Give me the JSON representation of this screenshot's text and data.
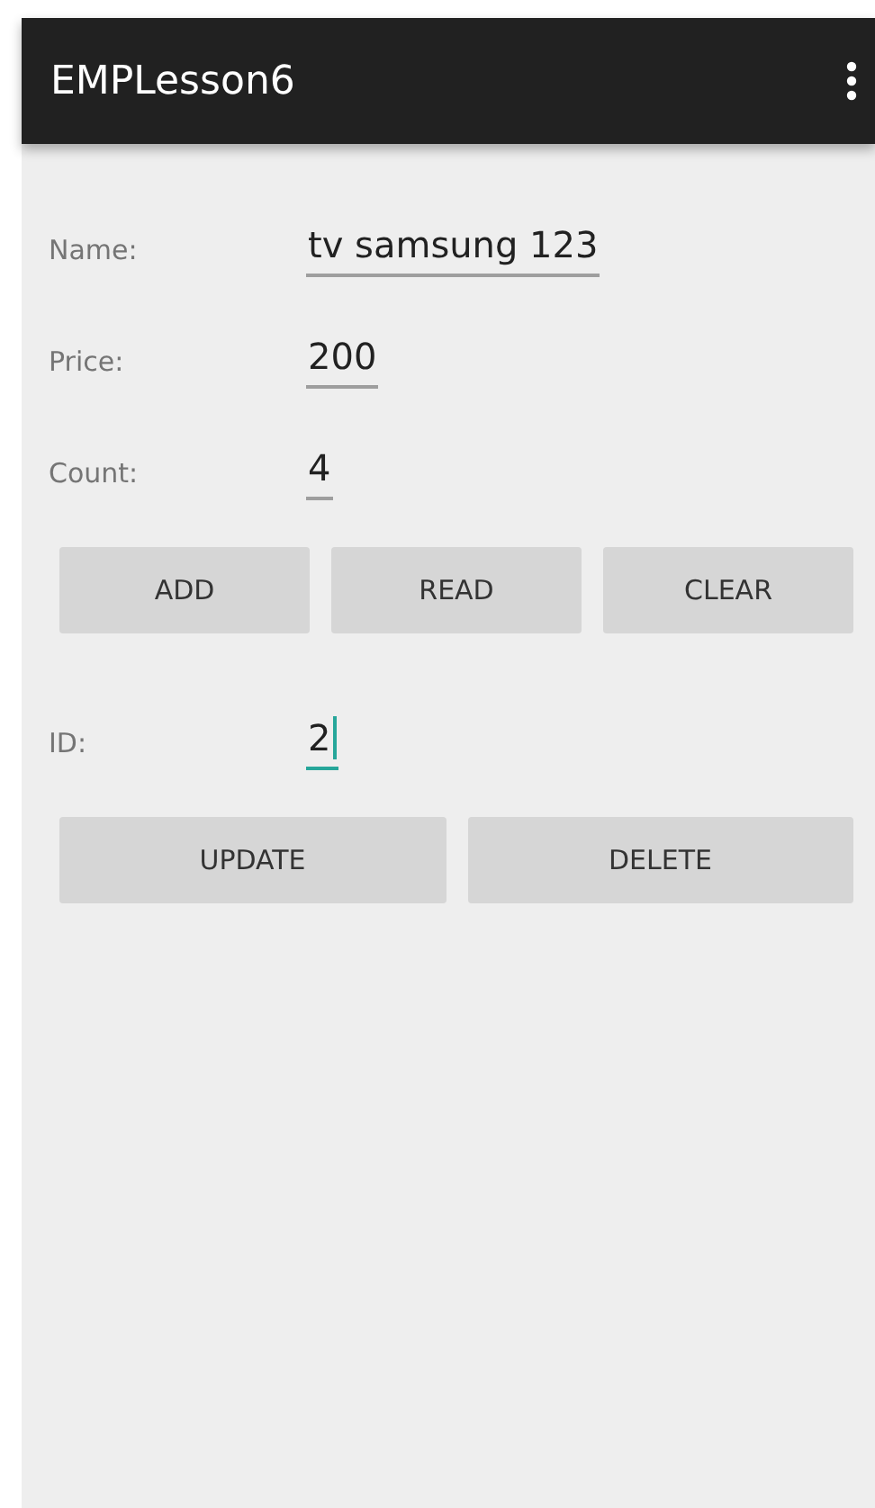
{
  "app_bar": {
    "title": "EMPLesson6"
  },
  "sections": [
    {
      "fields": [
        {
          "label": "Name:",
          "value": "tv samsung 123",
          "focused": false
        },
        {
          "label": "Price:",
          "value": "200",
          "focused": false
        },
        {
          "label": "Count:",
          "value": "4",
          "focused": false
        }
      ],
      "buttons": [
        "ADD",
        "READ",
        "CLEAR"
      ]
    },
    {
      "fields": [
        {
          "label": "ID:",
          "value": "2",
          "focused": true
        }
      ],
      "buttons": [
        "UPDATE",
        "DELETE"
      ]
    }
  ]
}
